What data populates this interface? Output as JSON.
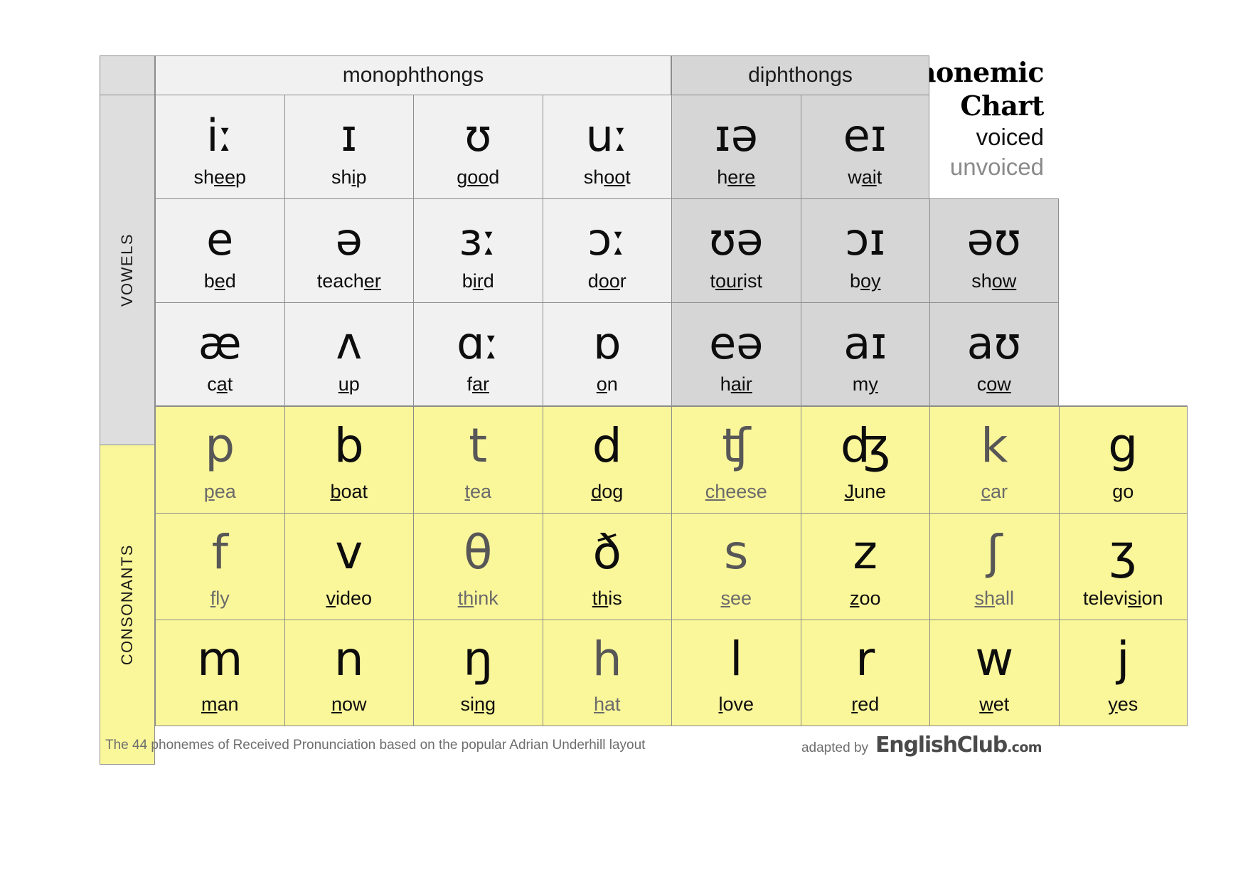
{
  "title": {
    "line1": "Phonemic",
    "line2": "Chart",
    "voiced_label": "voiced",
    "unvoiced_label": "unvoiced",
    "voiced_color": "#111111",
    "unvoiced_color": "#8a8a8a"
  },
  "rails": {
    "vowels": "VOWELS",
    "consonants": "CONSONANTS"
  },
  "bands": {
    "monophthongs": "monophthongs",
    "diphthongs": "diphthongs"
  },
  "colors": {
    "monophthong_bg": "#f1f1f1",
    "diphthong_bg": "#d6d6d6",
    "consonant_bg": "#faf69a",
    "rail_vowel_bg": "#dedede",
    "border": "#8c8c8c",
    "voiced_text": "#0d0d0d",
    "unvoiced_text": "#575757"
  },
  "footer": {
    "note": "The 44 phonemes of Received Pronunciation based on the popular Adrian Underhill layout",
    "adapted_by": "adapted by",
    "brand": "EnglishClub",
    "brand_tld": ".com"
  },
  "chart_data": {
    "type": "table",
    "title": "Phonemic Chart",
    "total_phonemes": 44,
    "vowel_rows": [
      [
        {
          "symbol": "iː",
          "word_pre": "sh",
          "word_mid": "ee",
          "word_post": "p",
          "group": "monophthong",
          "voicing": "voiced"
        },
        {
          "symbol": "ɪ",
          "word_pre": "sh",
          "word_mid": "i",
          "word_post": "p",
          "group": "monophthong",
          "voicing": "voiced"
        },
        {
          "symbol": "ʊ",
          "word_pre": "g",
          "word_mid": "oo",
          "word_post": "d",
          "group": "monophthong",
          "voicing": "voiced"
        },
        {
          "symbol": "uː",
          "word_pre": "sh",
          "word_mid": "oo",
          "word_post": "t",
          "group": "monophthong",
          "voicing": "voiced"
        },
        {
          "symbol": "ɪə",
          "word_pre": "h",
          "word_mid": "ere",
          "word_post": "",
          "group": "diphthong",
          "voicing": "voiced"
        },
        {
          "symbol": "eɪ",
          "word_pre": "w",
          "word_mid": "ai",
          "word_post": "t",
          "group": "diphthong",
          "voicing": "voiced"
        },
        null,
        null
      ],
      [
        {
          "symbol": "e",
          "word_pre": "b",
          "word_mid": "e",
          "word_post": "d",
          "group": "monophthong",
          "voicing": "voiced"
        },
        {
          "symbol": "ə",
          "word_pre": "teach",
          "word_mid": "er",
          "word_post": "",
          "group": "monophthong",
          "voicing": "voiced"
        },
        {
          "symbol": "ɜː",
          "word_pre": "b",
          "word_mid": "ir",
          "word_post": "d",
          "group": "monophthong",
          "voicing": "voiced"
        },
        {
          "symbol": "ɔː",
          "word_pre": "d",
          "word_mid": "oo",
          "word_post": "r",
          "group": "monophthong",
          "voicing": "voiced"
        },
        {
          "symbol": "ʊə",
          "word_pre": "t",
          "word_mid": "our",
          "word_post": "ist",
          "group": "diphthong",
          "voicing": "voiced"
        },
        {
          "symbol": "ɔɪ",
          "word_pre": "b",
          "word_mid": "oy",
          "word_post": "",
          "group": "diphthong",
          "voicing": "voiced"
        },
        {
          "symbol": "əʊ",
          "word_pre": "sh",
          "word_mid": "ow",
          "word_post": "",
          "group": "diphthong",
          "voicing": "voiced"
        },
        null
      ],
      [
        {
          "symbol": "æ",
          "word_pre": "c",
          "word_mid": "a",
          "word_post": "t",
          "group": "monophthong",
          "voicing": "voiced"
        },
        {
          "symbol": "ʌ",
          "word_pre": "",
          "word_mid": "u",
          "word_post": "p",
          "group": "monophthong",
          "voicing": "voiced"
        },
        {
          "symbol": "ɑː",
          "word_pre": "f",
          "word_mid": "ar",
          "word_post": "",
          "group": "monophthong",
          "voicing": "voiced"
        },
        {
          "symbol": "ɒ",
          "word_pre": "",
          "word_mid": "o",
          "word_post": "n",
          "group": "monophthong",
          "voicing": "voiced"
        },
        {
          "symbol": "eə",
          "word_pre": "h",
          "word_mid": "air",
          "word_post": "",
          "group": "diphthong",
          "voicing": "voiced"
        },
        {
          "symbol": "aɪ",
          "word_pre": "m",
          "word_mid": "y",
          "word_post": "",
          "group": "diphthong",
          "voicing": "voiced"
        },
        {
          "symbol": "aʊ",
          "word_pre": "c",
          "word_mid": "ow",
          "word_post": "",
          "group": "diphthong",
          "voicing": "voiced"
        },
        null
      ]
    ],
    "consonant_rows": [
      [
        {
          "symbol": "p",
          "word_pre": "",
          "word_mid": "p",
          "word_post": "ea",
          "voicing": "unvoiced"
        },
        {
          "symbol": "b",
          "word_pre": "",
          "word_mid": "b",
          "word_post": "oat",
          "voicing": "voiced"
        },
        {
          "symbol": "t",
          "word_pre": "",
          "word_mid": "t",
          "word_post": "ea",
          "voicing": "unvoiced"
        },
        {
          "symbol": "d",
          "word_pre": "",
          "word_mid": "d",
          "word_post": "og",
          "voicing": "voiced"
        },
        {
          "symbol": "ʧ",
          "word_pre": "",
          "word_mid": "ch",
          "word_post": "eese",
          "voicing": "unvoiced"
        },
        {
          "symbol": "ʤ",
          "word_pre": "",
          "word_mid": "J",
          "word_post": "une",
          "voicing": "voiced"
        },
        {
          "symbol": "k",
          "word_pre": "",
          "word_mid": "c",
          "word_post": "ar",
          "voicing": "unvoiced"
        },
        {
          "symbol": "g",
          "word_pre": "",
          "word_mid": "g",
          "word_post": "o",
          "voicing": "voiced"
        }
      ],
      [
        {
          "symbol": "f",
          "word_pre": "",
          "word_mid": "f",
          "word_post": "ly",
          "voicing": "unvoiced"
        },
        {
          "symbol": "v",
          "word_pre": "",
          "word_mid": "v",
          "word_post": "ideo",
          "voicing": "voiced"
        },
        {
          "symbol": "θ",
          "word_pre": "",
          "word_mid": "th",
          "word_post": "ink",
          "voicing": "unvoiced"
        },
        {
          "symbol": "ð",
          "word_pre": "",
          "word_mid": "th",
          "word_post": "is",
          "voicing": "voiced"
        },
        {
          "symbol": "s",
          "word_pre": "",
          "word_mid": "s",
          "word_post": "ee",
          "voicing": "unvoiced"
        },
        {
          "symbol": "z",
          "word_pre": "",
          "word_mid": "z",
          "word_post": "oo",
          "voicing": "voiced"
        },
        {
          "symbol": "ʃ",
          "word_pre": "",
          "word_mid": "sh",
          "word_post": "all",
          "voicing": "unvoiced"
        },
        {
          "symbol": "ʒ",
          "word_pre": "televi",
          "word_mid": "si",
          "word_post": "on",
          "voicing": "voiced"
        }
      ],
      [
        {
          "symbol": "m",
          "word_pre": "",
          "word_mid": "m",
          "word_post": "an",
          "voicing": "voiced"
        },
        {
          "symbol": "n",
          "word_pre": "",
          "word_mid": "n",
          "word_post": "ow",
          "voicing": "voiced"
        },
        {
          "symbol": "ŋ",
          "word_pre": "si",
          "word_mid": "ng",
          "word_post": "",
          "voicing": "voiced"
        },
        {
          "symbol": "h",
          "word_pre": "",
          "word_mid": "h",
          "word_post": "at",
          "voicing": "unvoiced"
        },
        {
          "symbol": "l",
          "word_pre": "",
          "word_mid": "l",
          "word_post": "ove",
          "voicing": "voiced"
        },
        {
          "symbol": "r",
          "word_pre": "",
          "word_mid": "r",
          "word_post": "ed",
          "voicing": "voiced"
        },
        {
          "symbol": "w",
          "word_pre": "",
          "word_mid": "w",
          "word_post": "et",
          "voicing": "voiced"
        },
        {
          "symbol": "j",
          "word_pre": "",
          "word_mid": "y",
          "word_post": "es",
          "voicing": "voiced"
        }
      ]
    ]
  }
}
